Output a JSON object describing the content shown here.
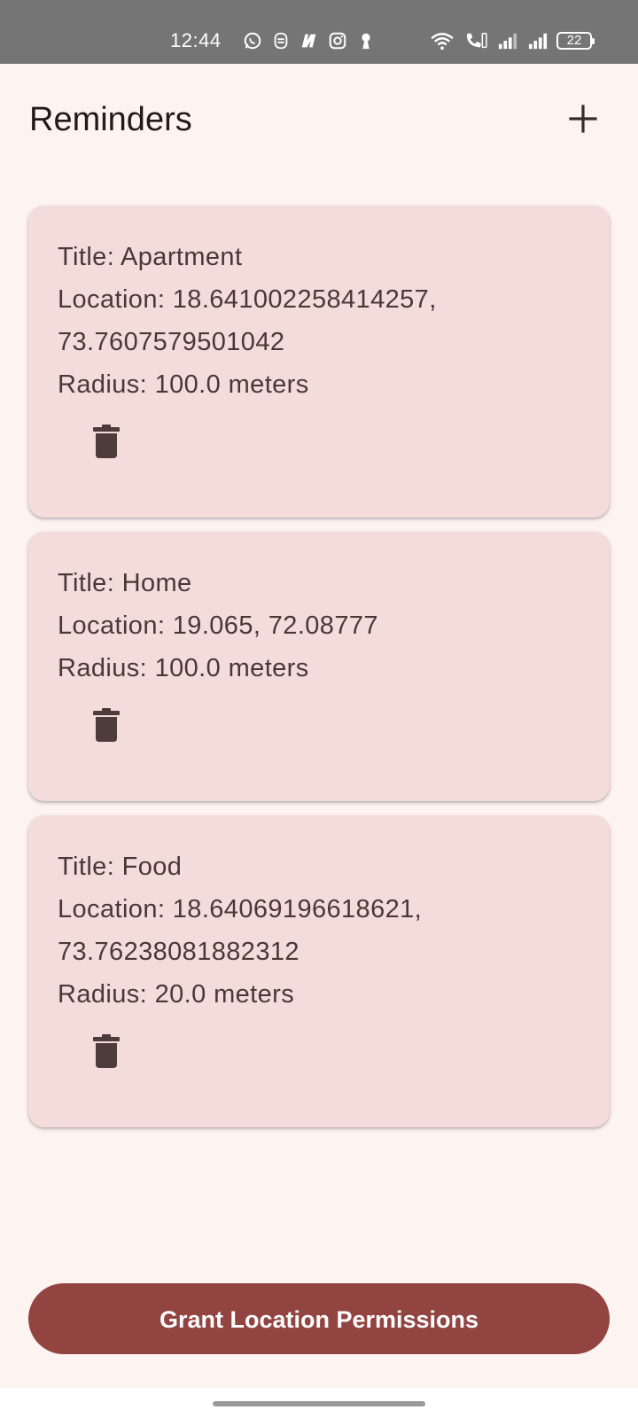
{
  "status_bar": {
    "time": "12:44",
    "battery": "22",
    "left_icons": [
      "whatsapp-icon",
      "notification-icon",
      "news-icon",
      "instagram-icon",
      "keyhole-icon"
    ],
    "right_icons": [
      "wifi-icon",
      "volte-call-icon",
      "signal-icon",
      "signal-icon"
    ]
  },
  "header": {
    "title": "Reminders",
    "add_icon": "plus-icon"
  },
  "reminders": [
    {
      "title": "Title: Apartment",
      "location_line1": "Location: 18.641002258414257,",
      "location_line2": "73.7607579501042",
      "radius": "Radius: 100.0 meters"
    },
    {
      "title": "Title: Home",
      "location_line1": "Location: 19.065, 72.08777",
      "radius": "Radius: 100.0 meters"
    },
    {
      "title": "Title: Food",
      "location_line1": "Location: 18.64069196618621,",
      "location_line2": "73.76238081882312",
      "radius": "Radius: 20.0 meters"
    }
  ],
  "actions": {
    "grant_label": "Grant Location Permissions"
  },
  "colors": {
    "background": "#fdf3f1",
    "card": "#f4dcdb",
    "primary_button": "#924441",
    "status_bar": "#757575"
  }
}
